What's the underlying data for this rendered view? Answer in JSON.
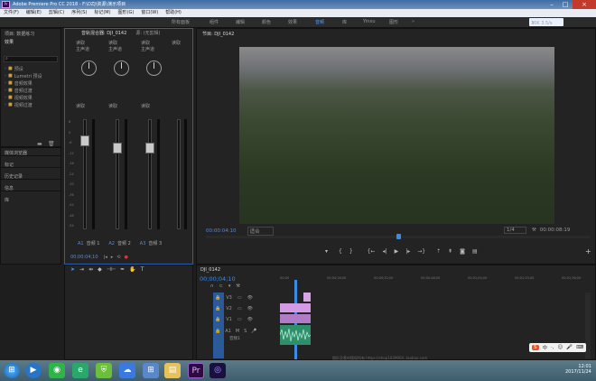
{
  "window": {
    "app_icon": "Pr",
    "title": "Adobe Premiere Pro CC 2018 - F:\\DZJ\\资源\\演示项目",
    "controls": [
      "minimize-icon",
      "maximize-icon",
      "close-icon"
    ]
  },
  "menu": [
    "文件(F)",
    "编辑(E)",
    "剪辑(C)",
    "序列(S)",
    "标记(M)",
    "图形(G)",
    "窗口(W)",
    "帮助(H)"
  ],
  "workspaces": {
    "items": [
      "所有面板",
      "组件",
      "编辑",
      "颜色",
      "效果",
      "音频",
      "库",
      "Yinxu",
      "图形"
    ],
    "active_index": 5
  },
  "tray_badge": "10K 3.5/s",
  "project": {
    "title": "项目: 数据练习",
    "section": "效果",
    "search_placeholder": "",
    "folders": [
      "预设",
      "Lumetri 预设",
      "音频效果",
      "音频过渡",
      "视频效果",
      "视频过渡"
    ],
    "lower_panels": [
      "媒体浏览器",
      "标记",
      "历史记录",
      "信息",
      "库"
    ]
  },
  "mixer": {
    "title": "音轨混合器: DJI_0142",
    "tab2": "源: (无剪辑)",
    "channels": [
      {
        "mode": "读取",
        "output": "主声道",
        "label": "A1",
        "name": "音频 1",
        "value": "0.0"
      },
      {
        "mode": "读取",
        "output": "主声道",
        "label": "A2",
        "name": "音频 2",
        "value": "0.0"
      },
      {
        "mode": "读取",
        "output": "主声道",
        "label": "A3",
        "name": "音频 3",
        "value": "0.0"
      }
    ],
    "db_scale": [
      "6",
      "0",
      "-6",
      "-12",
      "-18",
      "-24",
      "-30",
      "-36",
      "-42",
      "-48",
      "-54"
    ],
    "timecode": "00;00;04;10"
  },
  "program": {
    "title": "节目: DJI_0142",
    "timecode": "00:00:04:10",
    "fit": "适合",
    "resolution": "1/4",
    "duration": "00:00:08:19",
    "playhead_fraction": 0.5
  },
  "timeline": {
    "sequence": "DJI_0142",
    "timecode": "00;00;04;10",
    "ruler": [
      "00;00",
      "00;00;16;00",
      "00;00;32;00",
      "00;00;48;00",
      "00;01;04;00",
      "00;01;20;00",
      "00;01;36;00"
    ],
    "tracks": [
      {
        "id": "V3"
      },
      {
        "id": "V2"
      },
      {
        "id": "V1"
      },
      {
        "id": "A1",
        "name": "音频1"
      }
    ],
    "watermark": "图形及素材版权所有 https://shop1039904..taobao.com"
  },
  "ime": {
    "label": "中"
  },
  "taskbar": {
    "time": "12:01",
    "date": "2017/11/24",
    "apps": [
      "start-orb-icon",
      "media-player-icon",
      "wechat-icon",
      "browser-icon",
      "shield-icon",
      "baidu-icon",
      "explorer-icon",
      "windows-icon",
      "premiere-icon",
      "after-effects-icon"
    ]
  }
}
